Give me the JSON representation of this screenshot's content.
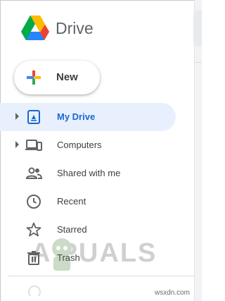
{
  "app": {
    "name": "Drive"
  },
  "new_button": {
    "label": "New"
  },
  "nav": [
    {
      "label": "My Drive",
      "icon": "my-drive-icon",
      "expandable": true,
      "active": true
    },
    {
      "label": "Computers",
      "icon": "computers-icon",
      "expandable": true,
      "active": false
    },
    {
      "label": "Shared with me",
      "icon": "shared-with-me-icon",
      "expandable": false,
      "active": false
    },
    {
      "label": "Recent",
      "icon": "clock-icon",
      "expandable": false,
      "active": false
    },
    {
      "label": "Starred",
      "icon": "star-icon",
      "expandable": false,
      "active": false
    },
    {
      "label": "Trash",
      "icon": "trash-icon",
      "expandable": false,
      "active": false
    }
  ],
  "watermark": {
    "text": "A PUALS"
  },
  "credit": "wsxdn.com",
  "colors": {
    "accent": "#1967d2",
    "active_bg": "#e8f0fe",
    "text": "#3c4043",
    "icon": "#5f6368"
  }
}
